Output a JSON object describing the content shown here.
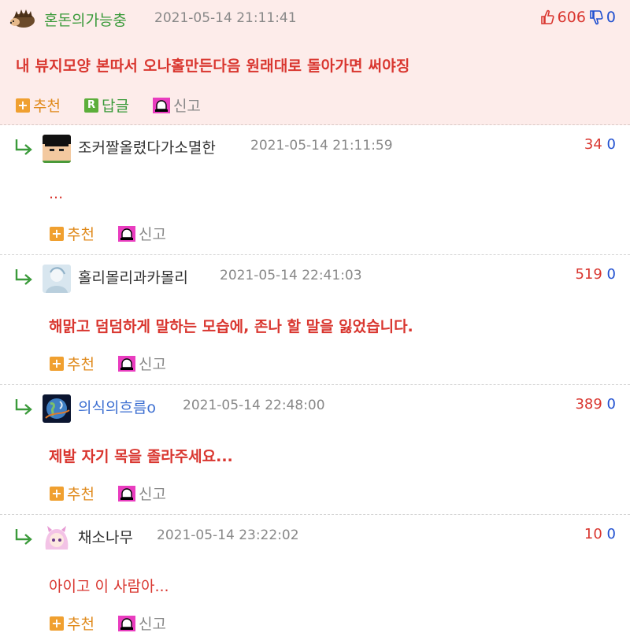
{
  "post": {
    "author": "혼돈의가능충",
    "timestamp": "2021-05-14 21:11:41",
    "upvotes": "606",
    "downvotes": "0",
    "body": "내 뷰지모양 본따서 오나홀만든다음 원래대로 돌아가면 써야징",
    "actions": {
      "recommend": "추천",
      "reply": "답글",
      "report": "신고"
    },
    "author_icon": "hedgehog-icon"
  },
  "comments": [
    {
      "author": "조커짤올렸다가소멸한",
      "timestamp": "2021-05-14 21:11:59",
      "upvotes": "34",
      "downvotes": "0",
      "body": "...",
      "avatar": "pixel-face-avatar"
    },
    {
      "author": "홀리몰리과카몰리",
      "timestamp": "2021-05-14 22:41:03",
      "upvotes": "519",
      "downvotes": "0",
      "body": "해맑고 덤덤하게 말하는 모습에, 존나 할 말을 잃었습니다.",
      "avatar": "light-blue-avatar"
    },
    {
      "author": "의식의흐름o",
      "timestamp": "2021-05-14 22:48:00",
      "upvotes": "389",
      "downvotes": "0",
      "body": "제발 자기 목을 졸라주세요...",
      "avatar": "earth-avatar"
    },
    {
      "author": "채소나무",
      "timestamp": "2021-05-14 23:22:02",
      "upvotes": "10",
      "downvotes": "0",
      "body": "아이고 이 사람아...",
      "avatar": "anime-girl-avatar"
    }
  ],
  "comment_actions": {
    "recommend": "추천",
    "report": "신고"
  },
  "colors": {
    "accent_red": "#d9362f",
    "accent_green": "#3a9a3a",
    "vote_blue": "#1f4fd0",
    "post_bg": "#fdecea"
  }
}
